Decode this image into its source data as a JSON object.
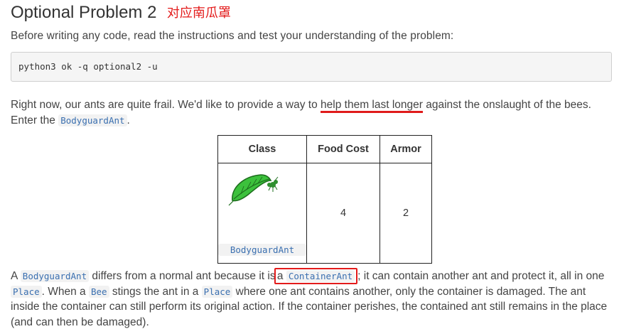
{
  "heading": {
    "title": "Optional Problem 2",
    "annotation": "对应南瓜罩"
  },
  "intro_text": "Before writing any code, read the instructions and test your understanding of the problem:",
  "command": "python3 ok -q optional2 -u",
  "paragraph1": {
    "part1": "Right now, our ants are quite frail. We'd like to provide a way to ",
    "highlight": "help them last longer",
    "part2": " against the onslaught of the bees. Enter the ",
    "code": "BodyguardAnt",
    "part3": "."
  },
  "table": {
    "headers": [
      "Class",
      "Food Cost",
      "Armor"
    ],
    "row": {
      "class_name": "BodyguardAnt",
      "food_cost": "4",
      "armor": "2",
      "image": "leaf-ant-icon"
    }
  },
  "paragraph2": {
    "t1": "A ",
    "c1": "BodyguardAnt",
    "t2": " differs from a normal ant because it is ",
    "boxed_word": "a",
    "c2": "ContainerAnt",
    "t3": "; it can contain another ant and protect it, all in one ",
    "c3": "Place",
    "t4": ". When a ",
    "c4": "Bee",
    "t5": " stings the ant in a ",
    "c5": "Place",
    "t6": " where one ant contains another, only the container is damaged. The ant inside the container can still perform its original action. If the container perishes, the contained ant still remains in the place (and can then be damaged)."
  },
  "colors": {
    "annotation": "#e31b1b",
    "code_text": "#3a6fb0",
    "leaf": "#3cc13c"
  }
}
